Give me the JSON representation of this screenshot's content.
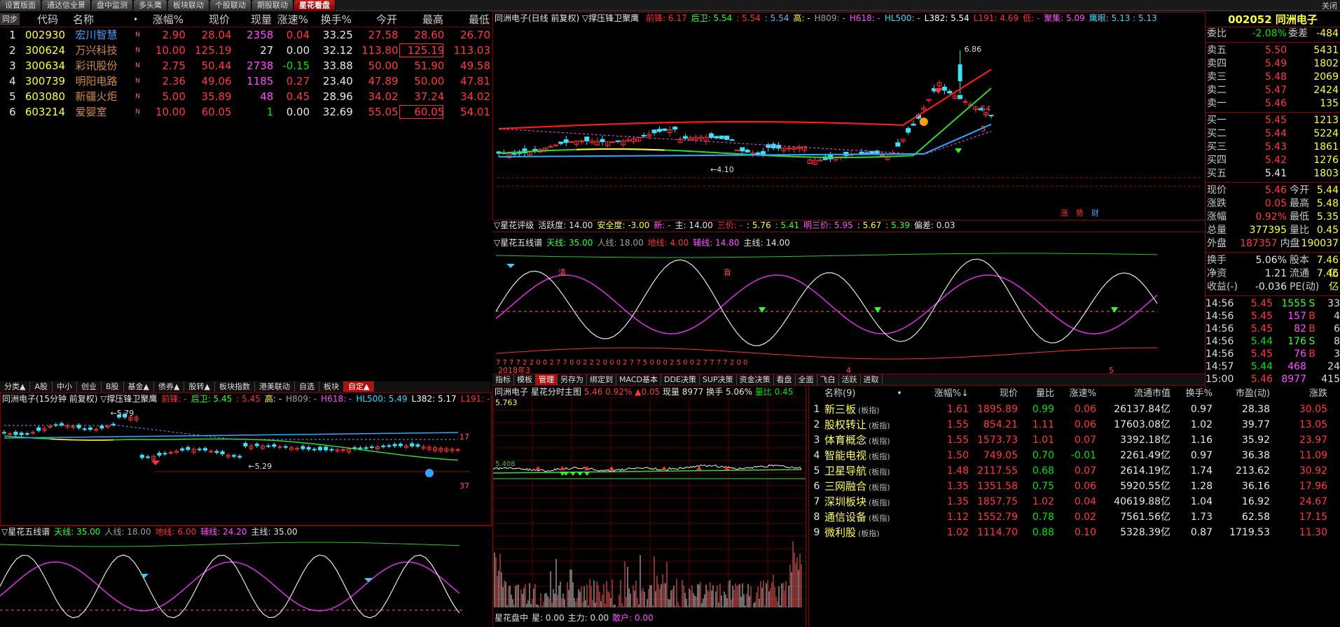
{
  "top_tabs": [
    "设置版面",
    "通达信全景",
    "盘中监测",
    "多头鹰",
    "板块联动",
    "个股联动",
    "期股联动",
    "星花看盘"
  ],
  "close_label": "关闭",
  "watch": {
    "headers": [
      "同步",
      "代码",
      "名称",
      "•",
      "涨幅%",
      "现价",
      "现量",
      "涨速%",
      "换手%",
      "今开",
      "最高",
      "最低"
    ],
    "rows": [
      {
        "n": "1",
        "code": "002930",
        "name": "宏川智慧",
        "flag": "N",
        "chg": "2.90",
        "price": "28.04",
        "vol": "2358",
        "spd": "0.04",
        "turn": "33.25",
        "open": "27.58",
        "high": "28.60",
        "low": "26.70"
      },
      {
        "n": "2",
        "code": "300624",
        "name": "万兴科技",
        "flag": "N",
        "chg": "10.00",
        "price": "125.19",
        "vol": "27",
        "spd": "0.00",
        "turn": "32.12",
        "open": "113.80",
        "high": "125.19",
        "low": "113.03"
      },
      {
        "n": "3",
        "code": "300634",
        "name": "彩讯股份",
        "flag": "N",
        "chg": "2.75",
        "price": "50.44",
        "vol": "2738",
        "spd": "-0.15",
        "turn": "33.88",
        "open": "50.00",
        "high": "51.90",
        "low": "49.58"
      },
      {
        "n": "4",
        "code": "300739",
        "name": "明阳电路",
        "flag": "N",
        "chg": "2.36",
        "price": "49.06",
        "vol": "1185",
        "spd": "0.27",
        "turn": "23.40",
        "open": "47.89",
        "high": "50.00",
        "low": "47.81"
      },
      {
        "n": "5",
        "code": "603080",
        "name": "新疆火炬",
        "flag": "N",
        "chg": "5.00",
        "price": "35.89",
        "vol": "48",
        "spd": "0.45",
        "turn": "28.96",
        "open": "34.02",
        "high": "37.24",
        "low": "34.02"
      },
      {
        "n": "6",
        "code": "603214",
        "name": "爱婴室",
        "flag": "N",
        "chg": "10.00",
        "price": "60.05",
        "vol": "1",
        "spd": "0.00",
        "turn": "32.69",
        "open": "55.05",
        "high": "60.05",
        "low": "54.01"
      }
    ]
  },
  "main_chart": {
    "title": "同洲电子(日线 前复权) ▽撑压锋卫聚鹰",
    "legend": [
      {
        "t": "前锋: 6.17",
        "c": "#ff3030"
      },
      {
        "t": "后卫: 5.54",
        "c": "#30ff30"
      },
      {
        "t": ": 5.54",
        "c": "#ff3030"
      },
      {
        "t": ": 5.54",
        "c": "#40c8ff"
      },
      {
        "t": "高: -",
        "c": "#ffff40"
      },
      {
        "t": "H809: -",
        "c": "#a0a0a0"
      },
      {
        "t": "H618: -",
        "c": "#ff50ff"
      },
      {
        "t": "HL500: -",
        "c": "#40d8ff"
      },
      {
        "t": "L382: 5.54",
        "c": "#ffffff"
      },
      {
        "t": "L191: 4.69",
        "c": "#ff3030"
      },
      {
        "t": "低: -",
        "c": "#ff3030"
      },
      {
        "t": "聚集: 5.09",
        "c": "#ff50ff"
      },
      {
        "t": "鹰眼: 5.13 : 5.13",
        "c": "#40d8ff"
      }
    ],
    "high_label": "6.86",
    "low_label": "4.10",
    "right_a": "54",
    "right_b": "5",
    "events": [
      "涨",
      "势",
      "财"
    ]
  },
  "rating": {
    "title": "▽星花评级",
    "items": [
      {
        "t": "活跃度: 14.00",
        "c": "#e0e0e0"
      },
      {
        "t": "安全度: -3.00",
        "c": "#ffff40"
      },
      {
        "t": "新: -",
        "c": "#ff50ff"
      },
      {
        "t": "主: 14.00",
        "c": "#e0e0e0"
      },
      {
        "t": "三价: -",
        "c": "#ff3030"
      },
      {
        "t": ": 5.76",
        "c": "#ffff40"
      },
      {
        "t": ": 5.41",
        "c": "#30ff30"
      },
      {
        "t": "明三价: 5.95",
        "c": "#ff50ff"
      },
      {
        "t": ": 5.67",
        "c": "#ffff40"
      },
      {
        "t": ": 5.39",
        "c": "#30ff30"
      },
      {
        "t": "偏差: 0.03",
        "c": "#e0e0e0"
      }
    ]
  },
  "five_line": {
    "title": "▽星花五线谱",
    "items": [
      {
        "t": "天线: 35.00",
        "c": "#30ff30"
      },
      {
        "t": "人线: 18.00",
        "c": "#a0a0a0"
      },
      {
        "t": "地线: 4.00",
        "c": "#ff3030"
      },
      {
        "t": "辅线: 14.80",
        "c": "#ff50ff"
      },
      {
        "t": "主线: 14.00",
        "c": "#e0e0e0"
      }
    ],
    "sig_a": "清",
    "sig_b": "盲",
    "digits": "7 7 7 7 2 2 0 0 2 7 7 0 0 2 2 2 0 0 0   2 7 7 5 0 0 0 2 5 0 0      2 7 7 7 7 2 0 0",
    "date": "2018年3",
    "m4": "4",
    "m5": "5"
  },
  "main_tabs": [
    "指标",
    "模板",
    "管理",
    "另存为",
    "绑定到",
    "MACD基本",
    "DDE决策",
    "SUP决策",
    "资金决策",
    "看盘",
    "全面",
    "飞白",
    "活跃",
    "进取"
  ],
  "quote": {
    "code": "002052",
    "name": "同洲电子",
    "wb": {
      "l": "委比",
      "v": "-2.08%",
      "l2": "委差",
      "v2": "-484"
    },
    "sell": [
      {
        "l": "卖五",
        "p": "5.50",
        "v": "5431"
      },
      {
        "l": "卖四",
        "p": "5.49",
        "v": "1802"
      },
      {
        "l": "卖三",
        "p": "5.48",
        "v": "2069"
      },
      {
        "l": "卖二",
        "p": "5.47",
        "v": "2424"
      },
      {
        "l": "卖一",
        "p": "5.46",
        "v": "135"
      }
    ],
    "buy": [
      {
        "l": "买一",
        "p": "5.45",
        "v": "1213"
      },
      {
        "l": "买二",
        "p": "5.44",
        "v": "5224"
      },
      {
        "l": "买三",
        "p": "5.43",
        "v": "1861"
      },
      {
        "l": "买四",
        "p": "5.42",
        "v": "1276"
      },
      {
        "l": "买五",
        "p": "5.41",
        "v": "1803"
      }
    ],
    "stats": [
      {
        "a": "现价",
        "b": "5.46",
        "c": "今开",
        "d": "5.44"
      },
      {
        "a": "涨跌",
        "b": "0.05",
        "c": "最高",
        "d": "5.48"
      },
      {
        "a": "涨幅",
        "b": "0.92%",
        "c": "最低",
        "d": "5.35"
      },
      {
        "a": "总量",
        "b": "377395",
        "c": "量比",
        "d": "0.45"
      },
      {
        "a": "外盘",
        "b": "187357",
        "c": "内盘",
        "d": "190037"
      }
    ],
    "stats2": [
      {
        "a": "换手",
        "b": "5.06%",
        "c": "股本",
        "d": "7.46亿"
      },
      {
        "a": "净资",
        "b": "1.21",
        "c": "流通",
        "d": "7.46亿"
      },
      {
        "a": "收益(-)",
        "b": "-0.036",
        "c": "PE(动)",
        "d": "-"
      }
    ],
    "ticks": [
      {
        "t": "14:56",
        "p": "5.45",
        "v": "1555",
        "s": "S",
        "n": "33"
      },
      {
        "t": "14:56",
        "p": "5.45",
        "v": "157",
        "s": "B",
        "n": "4"
      },
      {
        "t": "14:56",
        "p": "5.45",
        "v": "82",
        "s": "B",
        "n": "6"
      },
      {
        "t": "14:56",
        "p": "5.44",
        "v": "176",
        "s": "S",
        "n": "8"
      },
      {
        "t": "14:56",
        "p": "5.45",
        "v": "76",
        "s": "B",
        "n": "3"
      },
      {
        "t": "14:57",
        "p": "5.44",
        "v": "468",
        "s": "",
        "n": "24"
      },
      {
        "t": "15:00",
        "p": "5.46",
        "v": "8977",
        "s": "",
        "n": "415"
      }
    ]
  },
  "lower_tabs": [
    "分类▲",
    "A股",
    "中小",
    "创业",
    "B股",
    "基金▲",
    "债券▲",
    "股转▲",
    "板块指数",
    "港美联动",
    "自选",
    "板块",
    "自定▲"
  ],
  "small_chart": {
    "title": "同洲电子(15分钟 前复权) ▽撑压锋卫聚鹰",
    "legend": [
      {
        "t": "前锋: -",
        "c": "#ff3030"
      },
      {
        "t": "后卫: 5.45",
        "c": "#30ff30"
      },
      {
        "t": ": 5.45",
        "c": "#ff3030"
      },
      {
        "t": "高: -",
        "c": "#ffff40"
      },
      {
        "t": "H809: -",
        "c": "#a0a0a0"
      },
      {
        "t": "H618: -",
        "c": "#ff50ff"
      },
      {
        "t": "HL500: 5.49",
        "c": "#40d8ff"
      },
      {
        "t": "L382: 5.17",
        "c": "#ffffff"
      },
      {
        "t": "L191: -",
        "c": "#ff3030"
      },
      {
        "t": "低: -",
        "c": "#ff3030"
      }
    ],
    "hi": "5.79",
    "lo": "5.29",
    "ra": "17",
    "rb": "37"
  },
  "small_five": {
    "title": "▽星花五线谱",
    "items": [
      {
        "t": "天线: 35.00",
        "c": "#30ff30"
      },
      {
        "t": "人线: 18.00",
        "c": "#a0a0a0"
      },
      {
        "t": "地线: 6.00",
        "c": "#ff3030"
      },
      {
        "t": "辅线: 24.20",
        "c": "#ff50ff"
      },
      {
        "t": "主线: 35.00",
        "c": "#e0e0e0"
      }
    ]
  },
  "intraday": {
    "title": "同洲电子",
    "sub": "星花分时主图",
    "chg": "5.46 0.92% ▲0.05",
    "vol": "现量 8977",
    "turn": "换手 5.06%",
    "vr": "量比 0.45",
    "top": "5.763",
    "mid": "5.408",
    "footer": [
      {
        "t": "星花盘中",
        "c": "#e0e0e0"
      },
      {
        "t": "星: 0.00",
        "c": "#e0e0e0"
      },
      {
        "t": "主力: 0.00",
        "c": "#e0e0e0"
      },
      {
        "t": "散户: 0.00",
        "c": "#ff50ff"
      }
    ]
  },
  "sector": {
    "headers": [
      "",
      "名称(9)",
      "•",
      "涨幅%↓",
      "现价",
      "量比",
      "涨速%",
      "流通市值",
      "换手%",
      "市盈(动)",
      "涨跌"
    ],
    "rows": [
      {
        "n": "1",
        "name": "新三板",
        "tag": "(板指)",
        "chg": "1.61",
        "price": "1895.89",
        "vr": "0.99",
        "spd": "0.06",
        "cap": "26137.84亿",
        "turn": "0.97",
        "pe": "28.38",
        "d": "30.05"
      },
      {
        "n": "2",
        "name": "股权转让",
        "tag": "(板指)",
        "chg": "1.55",
        "price": "854.21",
        "vr": "1.11",
        "spd": "0.06",
        "cap": "17603.08亿",
        "turn": "1.02",
        "pe": "39.77",
        "d": "13.05"
      },
      {
        "n": "3",
        "name": "体育概念",
        "tag": "(板指)",
        "chg": "1.55",
        "price": "1573.73",
        "vr": "1.01",
        "spd": "0.07",
        "cap": "3392.18亿",
        "turn": "1.16",
        "pe": "35.92",
        "d": "23.97"
      },
      {
        "n": "4",
        "name": "智能电视",
        "tag": "(板指)",
        "chg": "1.50",
        "price": "749.05",
        "vr": "0.70",
        "spd": "-0.01",
        "cap": "2261.49亿",
        "turn": "0.97",
        "pe": "36.38",
        "d": "11.09"
      },
      {
        "n": "5",
        "name": "卫星导航",
        "tag": "(板指)",
        "chg": "1.48",
        "price": "2117.55",
        "vr": "0.68",
        "spd": "0.07",
        "cap": "2614.19亿",
        "turn": "1.74",
        "pe": "213.62",
        "d": "30.92"
      },
      {
        "n": "6",
        "name": "三网融合",
        "tag": "(板指)",
        "chg": "1.35",
        "price": "1351.58",
        "vr": "0.75",
        "spd": "0.06",
        "cap": "5920.55亿",
        "turn": "1.28",
        "pe": "36.16",
        "d": "17.96"
      },
      {
        "n": "7",
        "name": "深圳板块",
        "tag": "(板指)",
        "chg": "1.35",
        "price": "1857.75",
        "vr": "1.02",
        "spd": "0.04",
        "cap": "40619.88亿",
        "turn": "1.04",
        "pe": "16.92",
        "d": "24.67"
      },
      {
        "n": "8",
        "name": "通信设备",
        "tag": "(板指)",
        "chg": "1.12",
        "price": "1552.79",
        "vr": "0.78",
        "spd": "0.02",
        "cap": "7561.56亿",
        "turn": "1.73",
        "pe": "62.58",
        "d": "17.15"
      },
      {
        "n": "9",
        "name": "微利股",
        "tag": "(板指)",
        "chg": "1.02",
        "price": "1114.70",
        "vr": "0.88",
        "spd": "0.10",
        "cap": "5328.39亿",
        "turn": "0.87",
        "pe": "1719.53",
        "d": "11.30"
      }
    ]
  }
}
